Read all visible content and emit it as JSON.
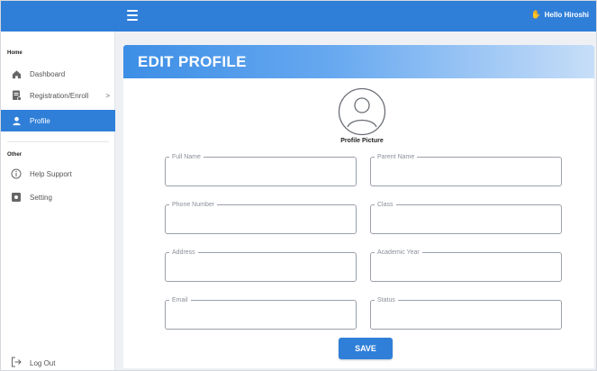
{
  "topbar": {
    "greeting": "Hello Hiroshi",
    "menu_icon": "hamburger-icon",
    "greeting_icon": "waving-hand-icon"
  },
  "sidebar": {
    "section_home": "Home",
    "section_other": "Other",
    "items": [
      {
        "label": "Dashboard",
        "icon": "home-icon"
      },
      {
        "label": "Registration/Enroll",
        "icon": "form-icon",
        "arrow": ">"
      },
      {
        "label": "Profile",
        "icon": "user-icon",
        "active": true
      },
      {
        "label": "Help Support",
        "icon": "info-icon"
      },
      {
        "label": "Setting",
        "icon": "gear-icon"
      }
    ],
    "logout_label": "Log Out",
    "logout_icon": "logout-icon"
  },
  "main": {
    "title": "EDIT PROFILE",
    "avatar_label": "Profile Picture",
    "avatar_icon": "avatar-icon",
    "fields": {
      "full_name": {
        "label": "Full Name",
        "value": ""
      },
      "parent_name": {
        "label": "Parent Name",
        "value": ""
      },
      "phone_number": {
        "label": "Phone Number",
        "value": ""
      },
      "class": {
        "label": "Class",
        "value": ""
      },
      "address": {
        "label": "Address",
        "value": ""
      },
      "academic_year": {
        "label": "Academic Year",
        "value": ""
      },
      "email": {
        "label": "Email",
        "value": ""
      },
      "status": {
        "label": "Status",
        "value": ""
      }
    },
    "save_label": "SAVE"
  },
  "colors": {
    "primary": "#2f7fd9",
    "header_gradient_start": "#3c8ee6",
    "header_gradient_end": "#c7def8",
    "page_bg": "#eef0f4"
  }
}
